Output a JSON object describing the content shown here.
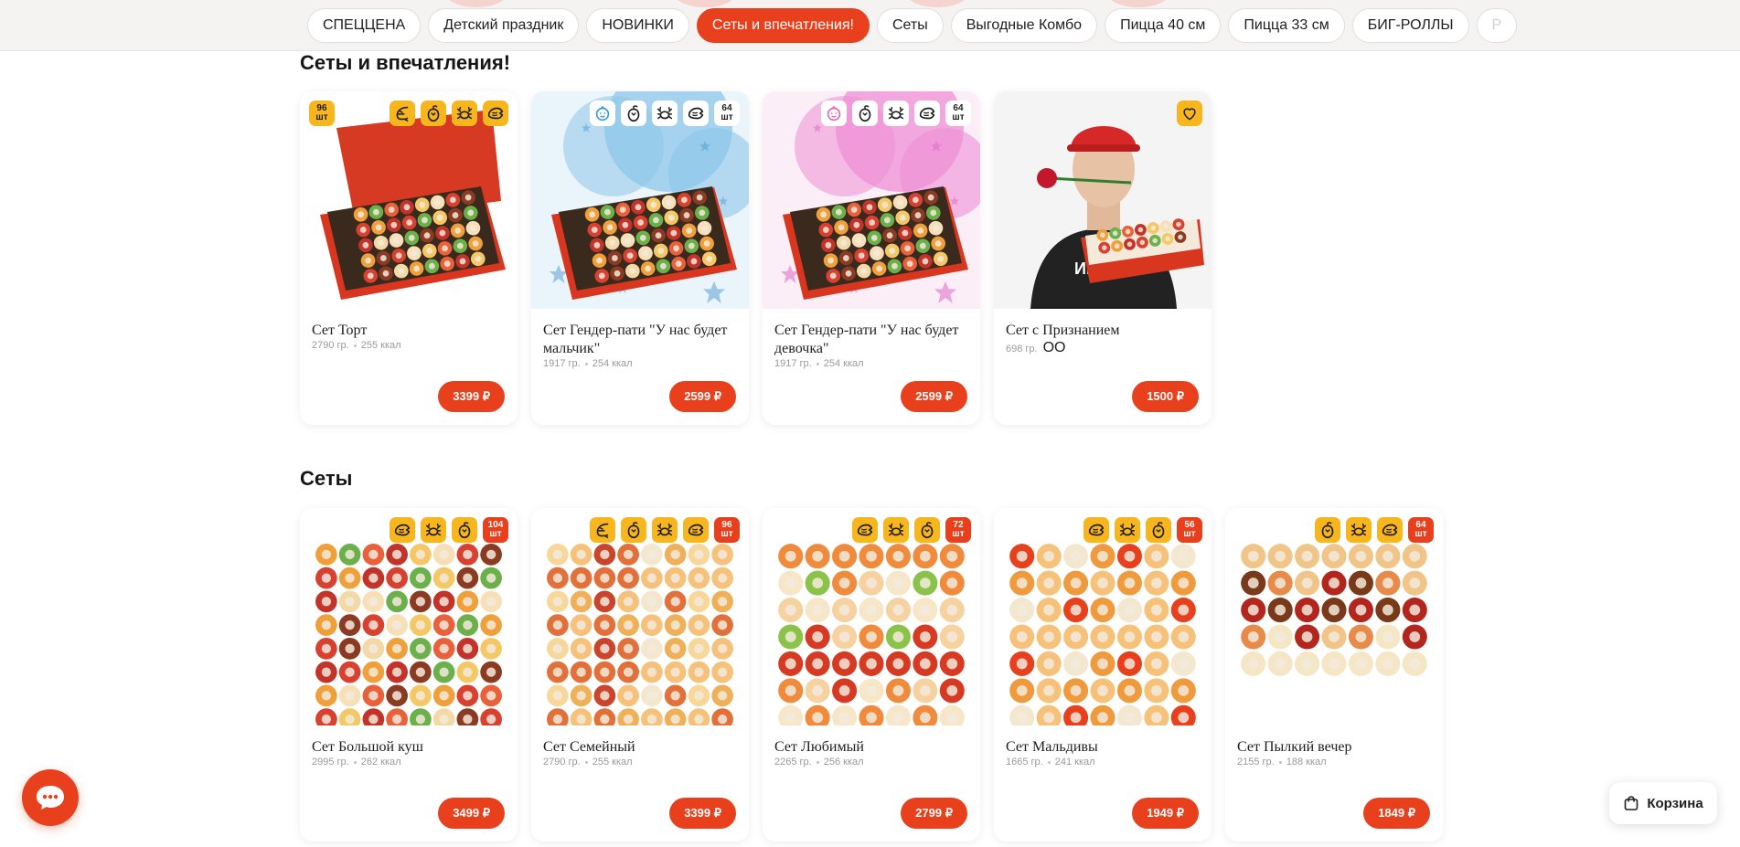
{
  "nav": {
    "tabs": [
      {
        "label": "СПЕЦЦЕНА"
      },
      {
        "label": "Детский праздник"
      },
      {
        "label": "НОВИНКИ"
      },
      {
        "label": "Сеты и впечатления!"
      },
      {
        "label": "Сеты"
      },
      {
        "label": "Выгодные Комбо"
      },
      {
        "label": "Пицца 40 см"
      },
      {
        "label": "Пицца 33 см"
      },
      {
        "label": "БИГ-РОЛЛЫ"
      },
      {
        "label": "Р"
      }
    ],
    "active_tab": "Сеты и впечатления!"
  },
  "sections": [
    {
      "title": "Сеты и впечатления!",
      "products": [
        {
          "name": "Сет Торт",
          "weight": "2790 гр.",
          "kcal": "255 ккал",
          "price": "3399 ₽",
          "count": "96",
          "count_unit": "шт",
          "icons": [
            "shrimp-icon",
            "pepper-icon",
            "crab-icon",
            "salmon-icon"
          ]
        },
        {
          "name": "Сет Гендер-пати \"У нас будет мальчик\"",
          "weight": "1917 гр.",
          "kcal": "254 ккал",
          "price": "2599 ₽",
          "count": "64",
          "count_unit": "шт",
          "icons": [
            "baby-icon",
            "pepper-icon",
            "crab-icon",
            "salmon-icon"
          ]
        },
        {
          "name": "Сет Гендер-пати \"У нас будет девочка\"",
          "weight": "1917 гр.",
          "kcal": "254 ккал",
          "price": "2599 ₽",
          "count": "64",
          "count_unit": "шт",
          "icons": [
            "baby-icon",
            "pepper-icon",
            "crab-icon",
            "salmon-icon"
          ]
        },
        {
          "name": "Сет с Признанием",
          "weight": "698 гр.",
          "extra": "OO",
          "price": "1500 ₽",
          "icons": [
            "heart-icon"
          ]
        }
      ]
    },
    {
      "title": "Сеты",
      "products": [
        {
          "name": "Сет Большой куш",
          "weight": "2995 гр.",
          "kcal": "262 ккал",
          "price": "3499 ₽",
          "count": "104",
          "count_unit": "шт",
          "icons": [
            "salmon-icon",
            "crab-icon",
            "pepper-icon"
          ]
        },
        {
          "name": "Сет Семейный",
          "weight": "2790 гр.",
          "kcal": "255 ккал",
          "price": "3399 ₽",
          "count": "96",
          "count_unit": "шт",
          "icons": [
            "shrimp-icon",
            "pepper-icon",
            "crab-icon",
            "salmon-icon"
          ]
        },
        {
          "name": "Сет Любимый",
          "weight": "2265 гр.",
          "kcal": "256 ккал",
          "price": "2799 ₽",
          "count": "72",
          "count_unit": "шт",
          "icons": [
            "salmon-icon",
            "crab-icon",
            "pepper-icon"
          ]
        },
        {
          "name": "Сет Мальдивы",
          "weight": "1665 гр.",
          "kcal": "241 ккал",
          "price": "1949 ₽",
          "count": "56",
          "count_unit": "шт",
          "icons": [
            "salmon-icon",
            "crab-icon",
            "pepper-icon"
          ]
        },
        {
          "name": "Сет Пылкий вечер",
          "weight": "2155 гр.",
          "kcal": "188 ккал",
          "price": "1849 ₽",
          "count": "64",
          "count_unit": "шт",
          "icons": [
            "pepper-icon",
            "crab-icon",
            "salmon-icon"
          ]
        }
      ]
    }
  ],
  "cart": {
    "label": "Корзина"
  },
  "colors": {
    "accent": "#e8401c",
    "badge_yellow": "#f7b51e",
    "page_bg": "#ffffff",
    "nav_bg": "#f4f3f1"
  }
}
